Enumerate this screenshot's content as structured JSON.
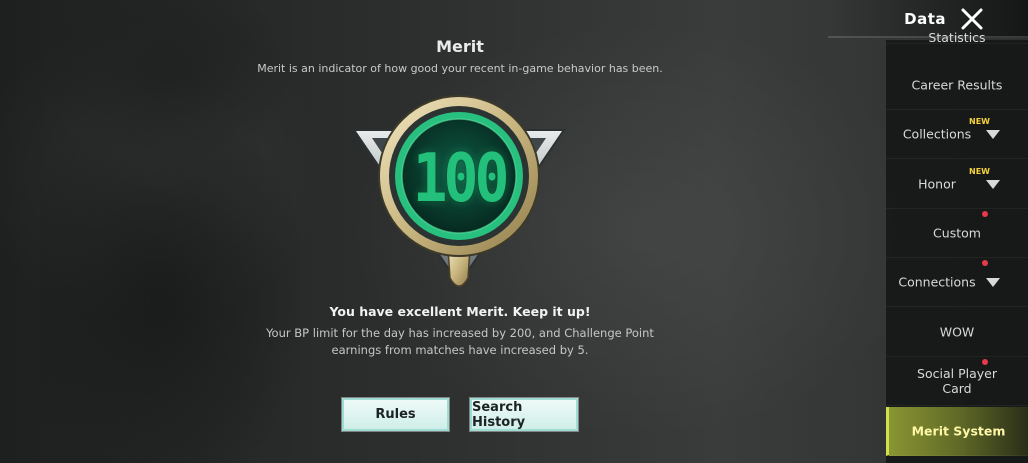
{
  "header": {
    "title": "Data",
    "close_icon": "close-icon"
  },
  "merit": {
    "title": "Merit",
    "description": "Merit is an indicator of how good your recent in-game behavior has been.",
    "score": "100",
    "status": "You have excellent Merit. Keep it up!",
    "detail_line1": "Your BP limit for the day has increased by 200, and Challenge Point",
    "detail_line2": "earnings from matches have increased by 5."
  },
  "buttons": {
    "rules": "Rules",
    "search_history": "Search History"
  },
  "sidebar": {
    "items": [
      {
        "label": "Statistics",
        "partial": true
      },
      {
        "label": "Career Results"
      },
      {
        "label": "Collections",
        "badge": "NEW",
        "chevron": true
      },
      {
        "label": "Honor",
        "badge": "NEW",
        "chevron": true
      },
      {
        "label": "Custom",
        "dot": true
      },
      {
        "label": "Connections",
        "dot": true,
        "chevron": true
      },
      {
        "label": "WOW"
      },
      {
        "label": "Social Player",
        "label2": "Card",
        "dot": true
      },
      {
        "label": "Merit System",
        "active": true
      }
    ]
  },
  "colors": {
    "accent_green": "#22c07a",
    "active_tab": "#8a9533",
    "new_badge": "#f7d33a",
    "notification_dot": "#e63a4a"
  }
}
